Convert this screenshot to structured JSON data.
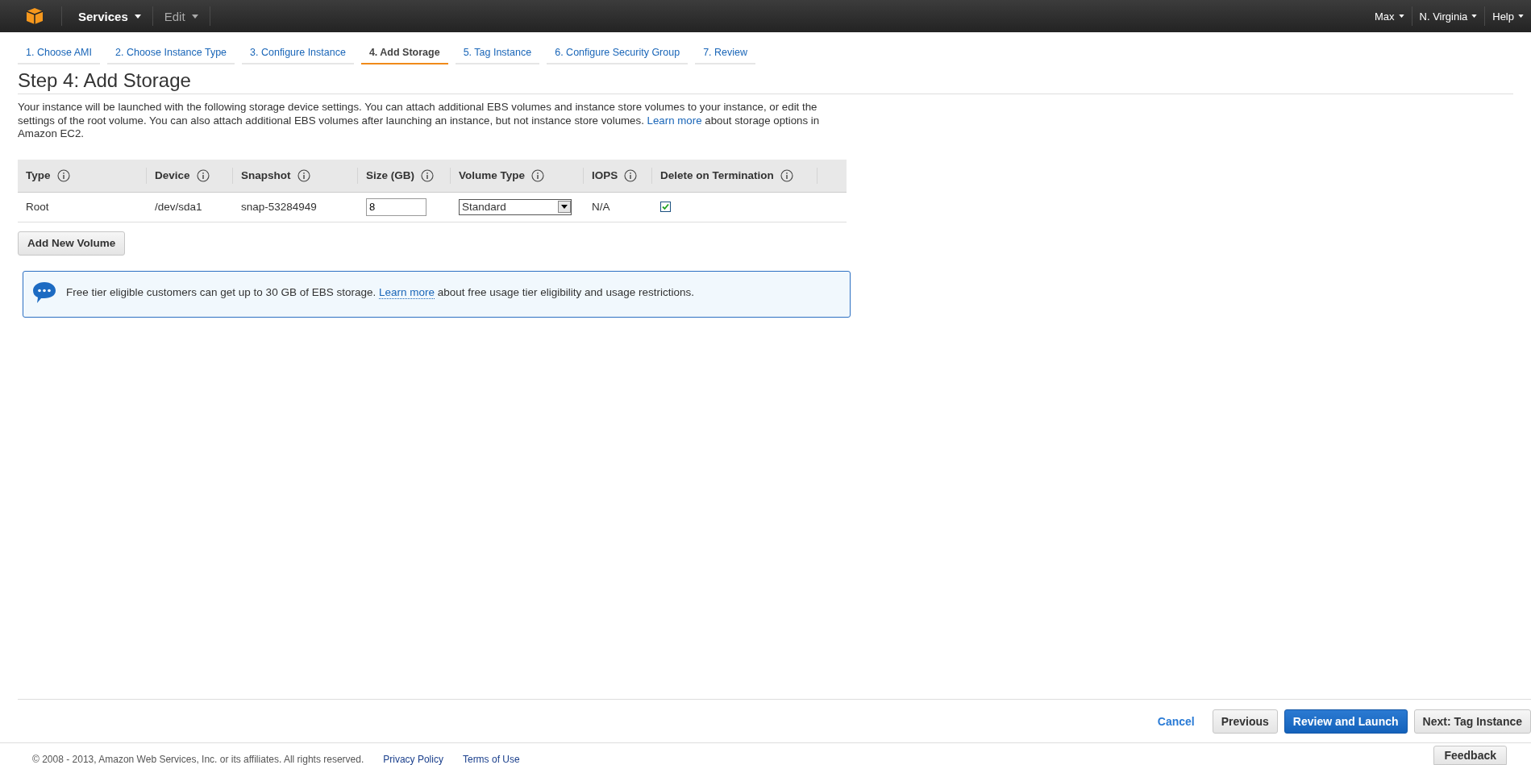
{
  "top_bar": {
    "menus": [
      {
        "label": "Services",
        "kind": "primary"
      },
      {
        "label": "Edit",
        "kind": "muted"
      }
    ],
    "right_menus": [
      "Max",
      "N. Virginia",
      "Help"
    ]
  },
  "steps": [
    {
      "label": "1. Choose AMI",
      "selected": false
    },
    {
      "label": "2. Choose Instance Type",
      "selected": false
    },
    {
      "label": "3. Configure Instance",
      "selected": false
    },
    {
      "label": "4. Add Storage",
      "selected": true
    },
    {
      "label": "5. Tag Instance",
      "selected": false
    },
    {
      "label": "6. Configure Security Group",
      "selected": false
    },
    {
      "label": "7. Review",
      "selected": false
    }
  ],
  "title": "Step 4: Add Storage",
  "description": {
    "before": "Your instance will be launched with the following storage device settings. You can attach additional EBS volumes and instance store volumes to your instance, or edit the settings of the root volume. You can also attach additional EBS volumes after launching an instance, but not instance store volumes.",
    "link": "Learn more",
    "after": "about storage options in Amazon EC2."
  },
  "table": {
    "columns": [
      "Type",
      "Device",
      "Snapshot",
      "Size (GB)",
      "Volume Type",
      "IOPS",
      "Delete on Termination"
    ],
    "rows": [
      {
        "type": "Root",
        "device": "/dev/sda1",
        "snapshot": "snap-53284949",
        "size": "8",
        "volume_type": "Standard",
        "iops": "N/A",
        "delete_on_termination": true
      }
    ]
  },
  "add_volume_button": "Add New Volume",
  "info": {
    "before": "Free tier eligible customers can get up to 30 GB of EBS storage.",
    "link": "Learn more",
    "after": "about free usage tier eligibility and usage restrictions."
  },
  "actions": {
    "cancel": "Cancel",
    "previous": "Previous",
    "primary": "Review and Launch",
    "next": "Next: Tag Instance"
  },
  "footer": {
    "copyright": "© 2008 - 2013, Amazon Web Services, Inc. or its affiliates. All rights reserved.",
    "links": [
      "Privacy Policy",
      "Terms of Use"
    ],
    "feedback": "Feedback"
  }
}
